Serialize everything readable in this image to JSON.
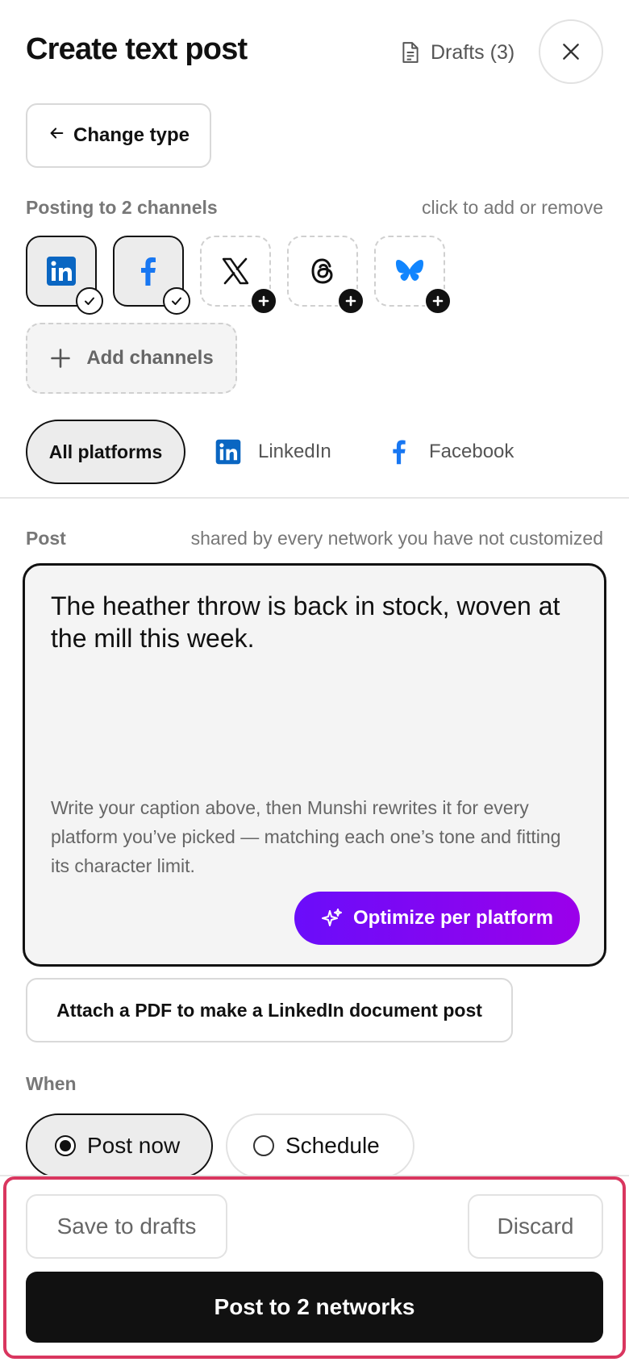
{
  "header": {
    "title": "Create text post",
    "drafts_label": "Drafts (3)",
    "drafts_icon": "document-icon",
    "close_icon": "close-icon"
  },
  "change_type": {
    "label": "Change type",
    "icon": "arrow-left-icon"
  },
  "channels": {
    "label": "Posting to 2 channels",
    "hint": "click to add or remove",
    "items": [
      {
        "name": "LinkedIn",
        "selected": true,
        "color": "#0a66c2"
      },
      {
        "name": "Facebook",
        "selected": true,
        "color": "#1877f2"
      },
      {
        "name": "X",
        "selected": false,
        "color": "#111111"
      },
      {
        "name": "Threads",
        "selected": false,
        "color": "#111111"
      },
      {
        "name": "Bluesky",
        "selected": false,
        "color": "#1185fe"
      }
    ],
    "add_label": "Add channels"
  },
  "tabs": {
    "all": "All platforms",
    "linkedin": "LinkedIn",
    "facebook": "Facebook"
  },
  "post": {
    "label": "Post",
    "hint": "shared by every network you have not customized",
    "text": "The heather throw is back in stock, woven at the mill this week.",
    "help": "Write your caption above, then Munshi rewrites it for every platform you’ve picked — matching each one’s tone and fitting its character limit.",
    "optimize_label": "Optimize per platform",
    "optimize_color_start": "#6a0dfa",
    "optimize_color_end": "#9b00ea"
  },
  "attach_pdf_label": "Attach a PDF to make a LinkedIn document post",
  "when": {
    "label": "When",
    "options": [
      "Post now",
      "Schedule"
    ],
    "selected": "Post now"
  },
  "footer": {
    "save_label": "Save to drafts",
    "discard_label": "Discard",
    "post_label": "Post to 2 networks",
    "highlight_color": "#d9365f"
  }
}
